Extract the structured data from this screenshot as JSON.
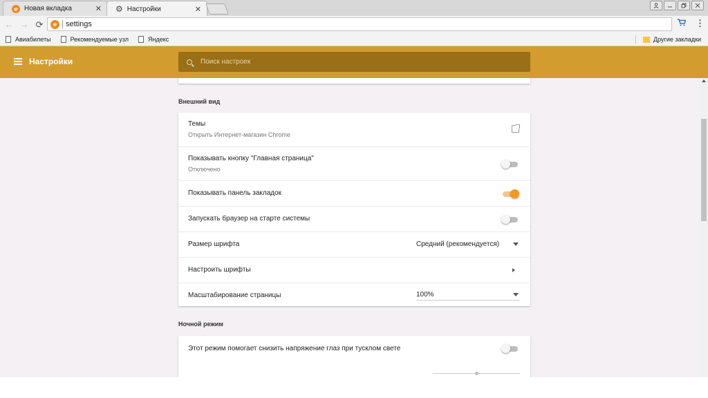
{
  "tabs": [
    {
      "title": "Новая вкладка",
      "icon": "browser-e-icon"
    },
    {
      "title": "Настройки",
      "icon": "gear-icon"
    }
  ],
  "tab_close": "✕",
  "toolbar": {
    "url": "settings"
  },
  "bookmarks": {
    "items": [
      "Авиабилеты",
      "Рекомендуемые узл",
      "Яндекс"
    ],
    "other": "Другие закладки"
  },
  "header": {
    "title": "Настройки",
    "search_placeholder": "Поиск настроек"
  },
  "appearance": {
    "section_title": "Внешний вид",
    "themes_label": "Темы",
    "themes_sub": "Открыть Интернет-магазин Chrome",
    "home_button_label": "Показывать кнопку \"Главная страница\"",
    "home_button_sub": "Отключено",
    "home_button_on": false,
    "bookmarks_bar_label": "Показывать панель закладок",
    "bookmarks_bar_on": true,
    "startup_label": "Запускать браузер на старте системы",
    "startup_on": false,
    "font_size_label": "Размер шрифта",
    "font_size_value": "Средний (рекомендуется)",
    "customize_fonts_label": "Настроить шрифты",
    "zoom_label": "Масштабирование страницы",
    "zoom_value": "100%"
  },
  "night_mode": {
    "section_title": "Ночной режим",
    "description": "Этот режим помогает снизить напряжение глаз при тусклом свете",
    "enabled": false,
    "slider_value_fraction": 0.5
  },
  "colors": {
    "accent": "#d29d2e",
    "search_bg": "#9a6f17",
    "toggle_on": "#f39a1e"
  }
}
